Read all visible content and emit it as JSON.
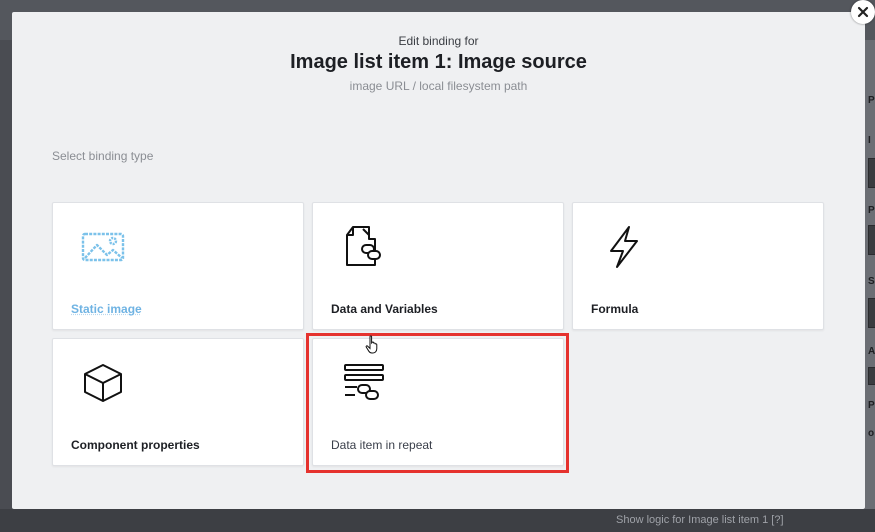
{
  "modal": {
    "subtitle": "Edit binding for",
    "title": "Image list item 1: Image source",
    "hint": "image URL / local filesystem path",
    "section_label": "Select binding type",
    "options": [
      {
        "label": "Static image",
        "icon": "image-icon",
        "state": "disabled"
      },
      {
        "label": "Data and Variables",
        "icon": "document-link-icon",
        "state": "normal"
      },
      {
        "label": "Formula",
        "icon": "lightning-icon",
        "state": "normal"
      },
      {
        "label": "Component properties",
        "icon": "cube-icon",
        "state": "normal"
      },
      {
        "label": "Data item in repeat",
        "icon": "list-link-icon",
        "state": "hover"
      }
    ]
  },
  "background": {
    "bottom_text": "Show logic for  Image list item 1  [?]"
  },
  "colors": {
    "highlight": "#e5322e",
    "disabled_label": "#6fb3e3",
    "modal_bg": "#eff0f2"
  }
}
